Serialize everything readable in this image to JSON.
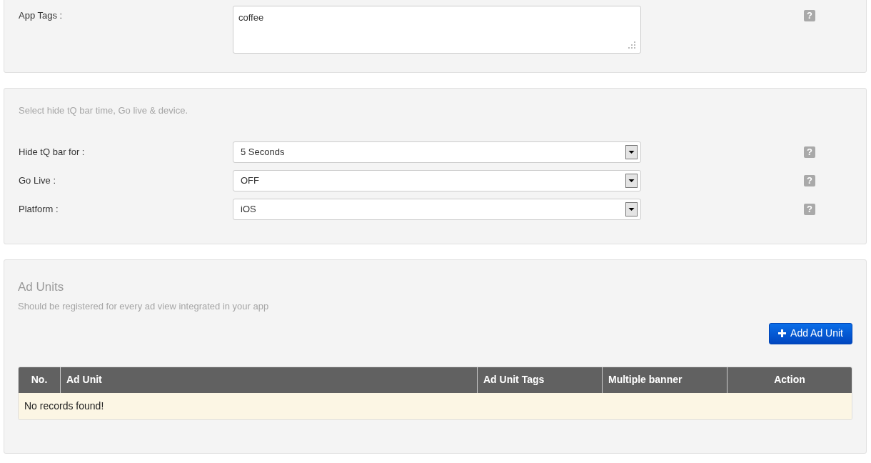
{
  "app_tags": {
    "label": "App Tags :",
    "value": "coffee",
    "help": "?"
  },
  "settings": {
    "description": "Select hide tQ bar time, Go live & device.",
    "fields": [
      {
        "label": "Hide tQ bar for :",
        "value": "5 Seconds",
        "help": "?"
      },
      {
        "label": "Go Live :",
        "value": "OFF",
        "help": "?"
      },
      {
        "label": "Platform :",
        "value": "iOS",
        "help": "?"
      }
    ]
  },
  "ad_units": {
    "title": "Ad Units",
    "subtitle": "Should be registered for every ad view integrated in your app",
    "add_button": "Add Ad Unit",
    "table": {
      "columns": [
        "No.",
        "Ad Unit",
        "Ad Unit Tags",
        "Multiple banner",
        "Action"
      ],
      "empty_message": "No records found!"
    }
  }
}
